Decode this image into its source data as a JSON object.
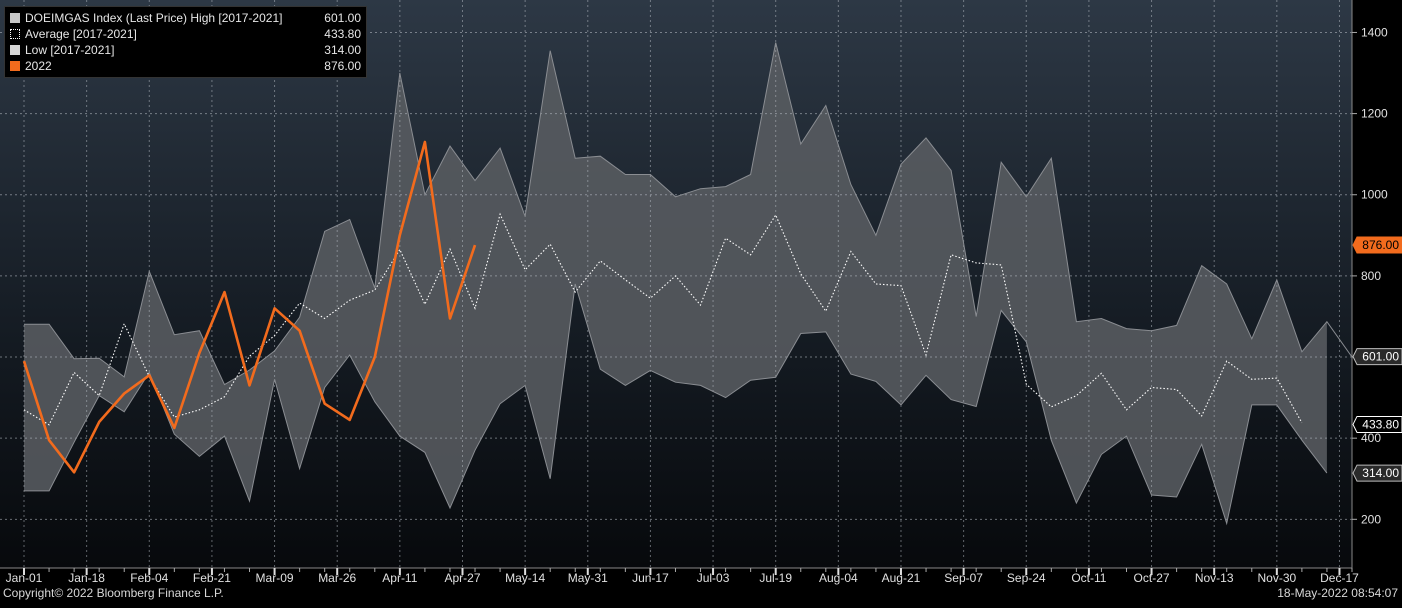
{
  "chart_data": {
    "type": "area",
    "ylim": [
      80,
      1480
    ],
    "y_ticks": [
      200,
      400,
      600,
      800,
      1000,
      1200,
      1400
    ],
    "x_ticks": [
      "Jan-01",
      "Jan-18",
      "Feb-04",
      "Feb-21",
      "Mar-09",
      "Mar-26",
      "Apr-11",
      "Apr-27",
      "May-14",
      "May-31",
      "Jun-17",
      "Jul-03",
      "Jul-19",
      "Aug-04",
      "Aug-21",
      "Sep-07",
      "Sep-24",
      "Oct-11",
      "Oct-27",
      "Nov-13",
      "Nov-30",
      "Dec-17"
    ],
    "weeks": 53,
    "grid": true,
    "legend_position": "top-left",
    "series": [
      {
        "name": "DOEIMGAS Index (Last Price) High [2017-2021]",
        "legend_value": "601.00",
        "color": "#c8c8c8",
        "values": [
          681,
          681,
          596,
          597,
          551,
          811,
          655,
          665,
          532,
          568,
          615,
          698,
          910,
          939,
          770,
          1300,
          1000,
          1120,
          1035,
          1115,
          947,
          1355,
          1090,
          1095,
          1050,
          1050,
          995,
          1015,
          1020,
          1050,
          1375,
          1125,
          1220,
          1025,
          900,
          1075,
          1140,
          1060,
          700,
          1080,
          995,
          1090,
          687,
          695,
          670,
          665,
          678,
          825,
          780,
          645,
          790,
          613,
          687,
          600
        ]
      },
      {
        "name": "Average [2017-2021]",
        "legend_value": "433.80",
        "color": "#ffffff",
        "values": [
          470,
          433,
          562,
          505,
          682,
          552,
          452,
          470,
          502,
          602,
          653,
          733,
          695,
          740,
          765,
          865,
          730,
          866,
          720,
          952,
          815,
          878,
          760,
          837,
          790,
          745,
          800,
          728,
          893,
          852,
          950,
          805,
          713,
          860,
          780,
          776,
          605,
          852,
          832,
          827,
          533,
          477,
          505,
          560,
          470,
          525,
          520,
          455,
          590,
          545,
          548,
          438
        ]
      },
      {
        "name": "Low [2017-2021]",
        "legend_value": "314.00",
        "color": "#d6d6d6",
        "values": [
          270,
          270,
          390,
          505,
          465,
          562,
          410,
          355,
          405,
          245,
          545,
          325,
          525,
          605,
          490,
          405,
          365,
          228,
          370,
          485,
          530,
          300,
          780,
          570,
          530,
          567,
          538,
          530,
          500,
          543,
          550,
          658,
          662,
          558,
          540,
          482,
          555,
          495,
          478,
          715,
          637,
          395,
          240,
          360,
          405,
          260,
          255,
          385,
          190,
          482,
          482,
          395,
          314
        ]
      },
      {
        "name": "2022",
        "legend_value": "876.00",
        "color": "#f26b1d",
        "values": [
          590,
          395,
          316,
          440,
          510,
          555,
          425,
          610,
          760,
          530,
          720,
          665,
          485,
          445,
          600,
          900,
          1130,
          695,
          876
        ]
      }
    ],
    "price_tags": [
      {
        "value": 876,
        "label": "876.00",
        "kind": "orange"
      },
      {
        "value": 601,
        "label": "601.00",
        "kind": "gray"
      },
      {
        "value": 433.8,
        "label": "433.80",
        "kind": "white"
      },
      {
        "value": 314,
        "label": "314.00",
        "kind": "gray"
      }
    ]
  },
  "footer": {
    "copyright": "Copyright© 2022 Bloomberg Finance L.P.",
    "timestamp": "18-May-2022 08:54:07"
  }
}
